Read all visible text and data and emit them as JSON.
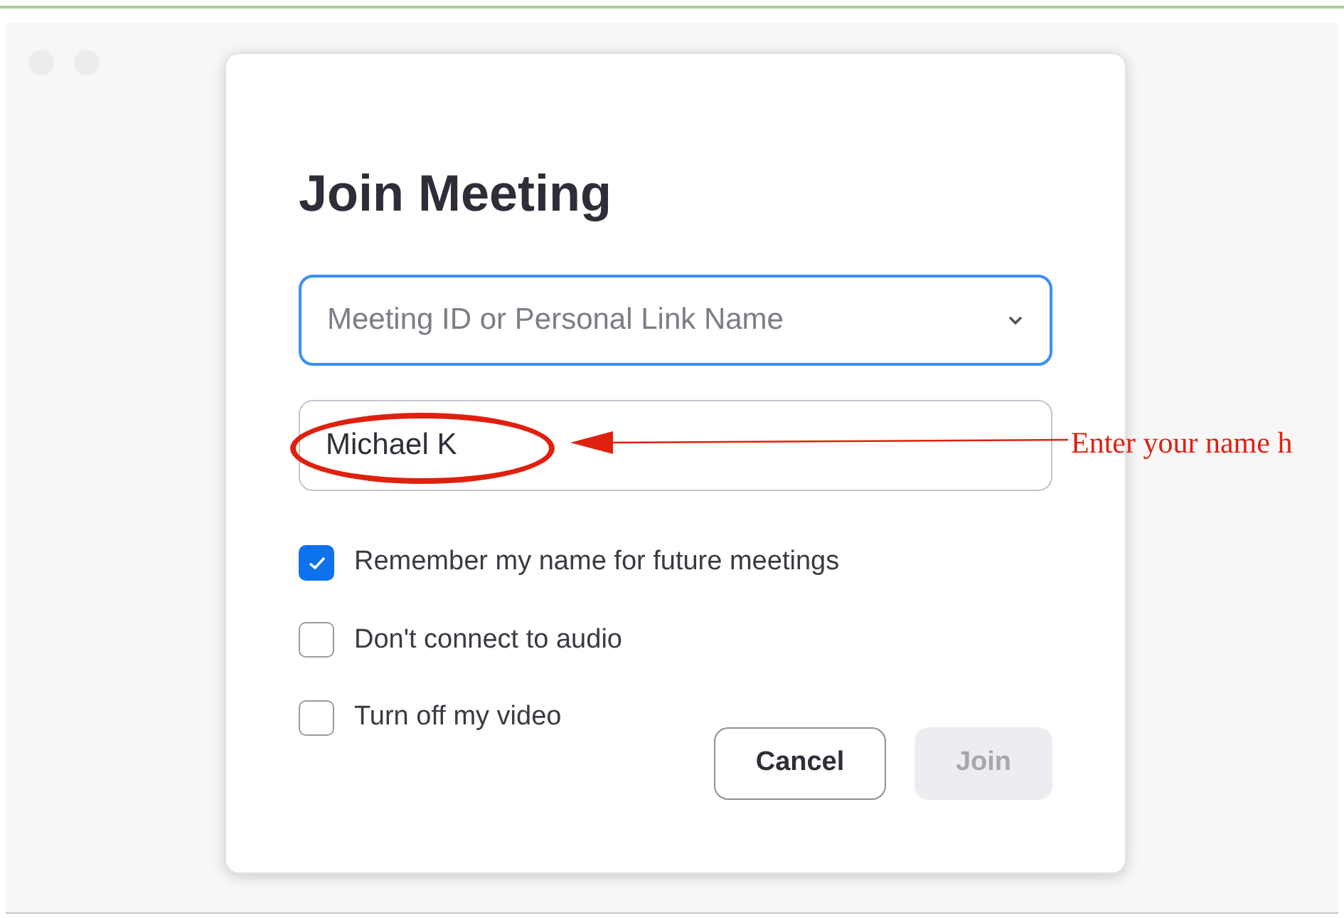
{
  "dialog": {
    "title": "Join Meeting",
    "meeting_field": {
      "placeholder": "Meeting ID or Personal Link Name",
      "focused": true
    },
    "name_field": {
      "value": "Michael K"
    },
    "options": [
      {
        "label": "Remember my name for future meetings",
        "checked": true
      },
      {
        "label": "Don't connect to audio",
        "checked": false
      },
      {
        "label": "Turn off my video",
        "checked": false
      }
    ],
    "buttons": [
      {
        "label": "Cancel",
        "disabled": false
      },
      {
        "label": "Join",
        "disabled": true
      }
    ]
  },
  "annotation": {
    "text": "Enter your name h"
  }
}
